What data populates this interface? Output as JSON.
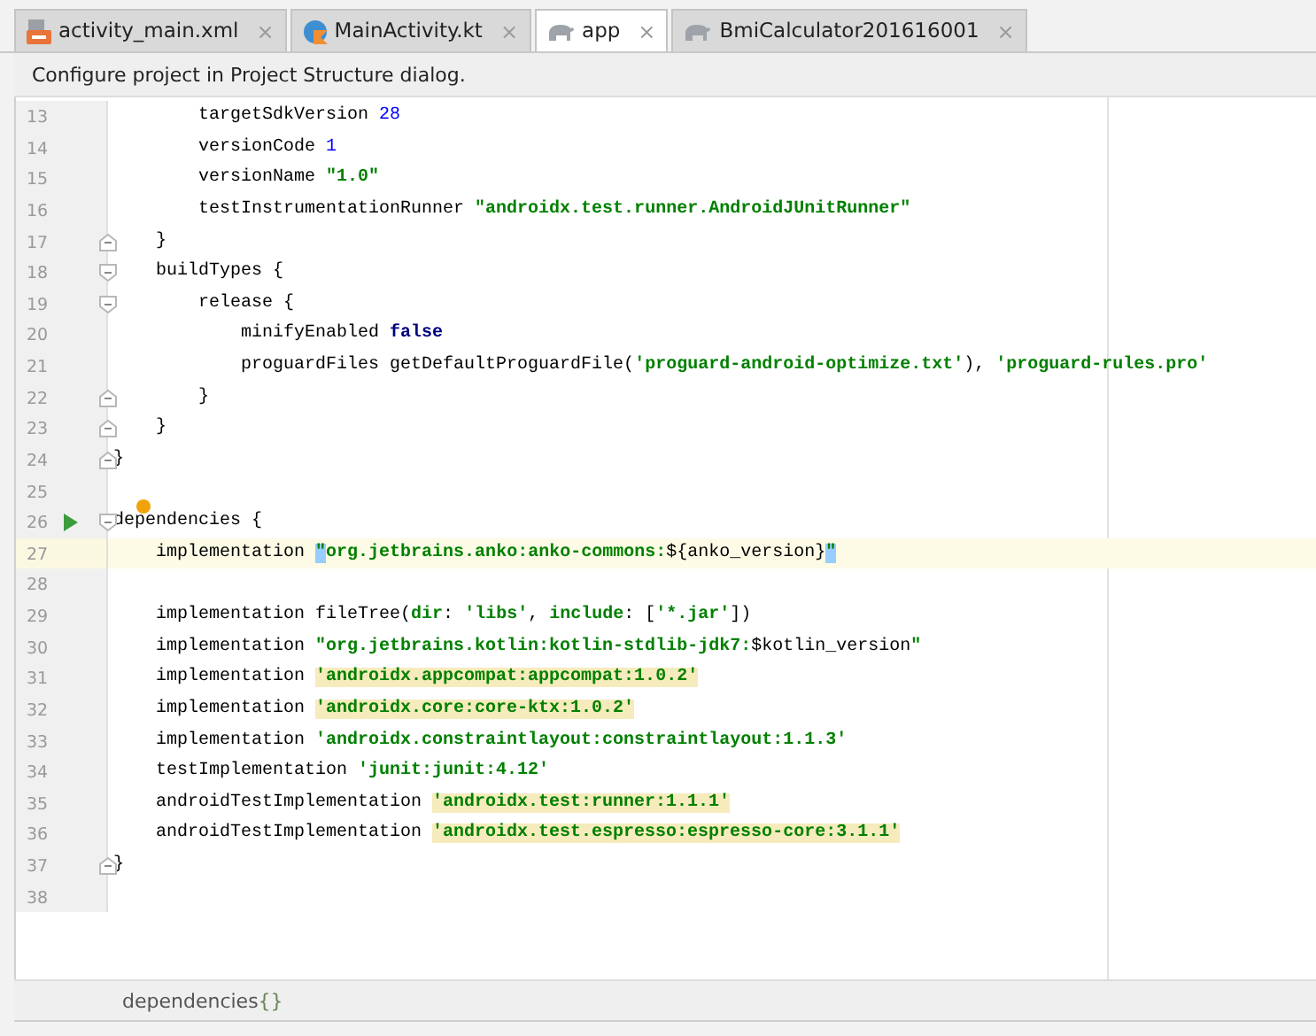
{
  "tabs": [
    {
      "label": "activity_main.xml",
      "selected": false,
      "close": "×"
    },
    {
      "label": "MainActivity.kt",
      "selected": false,
      "close": "×"
    },
    {
      "label": "app",
      "selected": true,
      "close": "×"
    },
    {
      "label": "BmiCalculator201616001",
      "selected": false,
      "close": "×"
    }
  ],
  "banner": "Configure project in Project Structure dialog.",
  "lines": [
    {
      "number": "13",
      "current": false,
      "fold_start": false,
      "fold_end": false,
      "runnable": false,
      "bulb": false,
      "tokens": [
        {
          "kind": "plain",
          "text": "        targetSdkVersion "
        },
        {
          "kind": "number",
          "text": "28"
        }
      ]
    },
    {
      "number": "14",
      "current": false,
      "fold_start": false,
      "fold_end": false,
      "runnable": false,
      "bulb": false,
      "tokens": [
        {
          "kind": "plain",
          "text": "        versionCode "
        },
        {
          "kind": "number",
          "text": "1"
        }
      ]
    },
    {
      "number": "15",
      "current": false,
      "fold_start": false,
      "fold_end": false,
      "runnable": false,
      "bulb": false,
      "tokens": [
        {
          "kind": "plain",
          "text": "        versionName "
        },
        {
          "kind": "string",
          "text": "\"1.0\""
        }
      ]
    },
    {
      "number": "16",
      "current": false,
      "fold_start": false,
      "fold_end": false,
      "runnable": false,
      "bulb": false,
      "tokens": [
        {
          "kind": "plain",
          "text": "        testInstrumentationRunner "
        },
        {
          "kind": "string",
          "text": "\"androidx.test.runner.AndroidJUnitRunner\""
        }
      ]
    },
    {
      "number": "17",
      "current": false,
      "fold_start": false,
      "fold_end": true,
      "runnable": false,
      "bulb": false,
      "tokens": [
        {
          "kind": "plain",
          "text": "    }"
        }
      ]
    },
    {
      "number": "18",
      "current": false,
      "fold_start": true,
      "fold_end": false,
      "runnable": false,
      "bulb": false,
      "tokens": [
        {
          "kind": "plain",
          "text": "    buildTypes {"
        }
      ]
    },
    {
      "number": "19",
      "current": false,
      "fold_start": true,
      "fold_end": false,
      "runnable": false,
      "bulb": false,
      "tokens": [
        {
          "kind": "plain",
          "text": "        release {"
        }
      ]
    },
    {
      "number": "20",
      "current": false,
      "fold_start": false,
      "fold_end": false,
      "runnable": false,
      "bulb": false,
      "tokens": [
        {
          "kind": "plain",
          "text": "            minifyEnabled "
        },
        {
          "kind": "keyword",
          "text": "false"
        }
      ]
    },
    {
      "number": "21",
      "current": false,
      "fold_start": false,
      "fold_end": false,
      "runnable": false,
      "bulb": false,
      "tokens": [
        {
          "kind": "plain",
          "text": "            proguardFiles getDefaultProguardFile("
        },
        {
          "kind": "string",
          "text": "'proguard-android-optimize.txt'"
        },
        {
          "kind": "plain",
          "text": "), "
        },
        {
          "kind": "string",
          "text": "'proguard-rules.pro'"
        }
      ]
    },
    {
      "number": "22",
      "current": false,
      "fold_start": false,
      "fold_end": true,
      "runnable": false,
      "bulb": false,
      "tokens": [
        {
          "kind": "plain",
          "text": "        }"
        }
      ]
    },
    {
      "number": "23",
      "current": false,
      "fold_start": false,
      "fold_end": true,
      "runnable": false,
      "bulb": false,
      "tokens": [
        {
          "kind": "plain",
          "text": "    }"
        }
      ]
    },
    {
      "number": "24",
      "current": false,
      "fold_start": false,
      "fold_end": true,
      "runnable": false,
      "bulb": false,
      "tokens": [
        {
          "kind": "plain",
          "text": "}"
        }
      ]
    },
    {
      "number": "25",
      "current": false,
      "fold_start": false,
      "fold_end": false,
      "runnable": false,
      "bulb": false
    },
    {
      "number": "26",
      "current": false,
      "fold_start": true,
      "fold_end": false,
      "runnable": true,
      "bulb": true,
      "tokens": [
        {
          "kind": "plain",
          "text": "dependencies {"
        }
      ]
    },
    {
      "number": "27",
      "current": true,
      "fold_start": false,
      "fold_end": false,
      "runnable": false,
      "bulb": false,
      "tokens": [
        {
          "kind": "plain",
          "text": "    implementation "
        },
        {
          "kind": "match",
          "text": "\""
        },
        {
          "kind": "string",
          "text": "org.jetbrains.anko:anko-commons:"
        },
        {
          "kind": "plain",
          "text": "${anko_version}"
        },
        {
          "kind": "match",
          "text": "\""
        }
      ]
    },
    {
      "number": "28",
      "current": false,
      "fold_start": false,
      "fold_end": false,
      "runnable": false,
      "bulb": false
    },
    {
      "number": "29",
      "current": false,
      "fold_start": false,
      "fold_end": false,
      "runnable": false,
      "bulb": false,
      "tokens": [
        {
          "kind": "plain",
          "text": "    implementation fileTree("
        },
        {
          "kind": "string",
          "text": "dir"
        },
        {
          "kind": "plain",
          "text": ": "
        },
        {
          "kind": "string",
          "text": "'libs'"
        },
        {
          "kind": "plain",
          "text": ", "
        },
        {
          "kind": "string",
          "text": "include"
        },
        {
          "kind": "plain",
          "text": ": ["
        },
        {
          "kind": "string",
          "text": "'*.jar'"
        },
        {
          "kind": "plain",
          "text": "])"
        }
      ]
    },
    {
      "number": "30",
      "current": false,
      "fold_start": false,
      "fold_end": false,
      "runnable": false,
      "bulb": false,
      "tokens": [
        {
          "kind": "plain",
          "text": "    implementation "
        },
        {
          "kind": "string",
          "text": "\"org.jetbrains.kotlin:kotlin-stdlib-jdk7:"
        },
        {
          "kind": "plain",
          "text": "$kotlin_version"
        },
        {
          "kind": "string",
          "text": "\""
        }
      ]
    },
    {
      "number": "31",
      "current": false,
      "fold_start": false,
      "fold_end": false,
      "runnable": false,
      "bulb": false,
      "tokens": [
        {
          "kind": "plain",
          "text": "    implementation "
        },
        {
          "kind": "warn",
          "text": "'androidx.appcompat:appcompat:1.0.2'"
        }
      ]
    },
    {
      "number": "32",
      "current": false,
      "fold_start": false,
      "fold_end": false,
      "runnable": false,
      "bulb": false,
      "tokens": [
        {
          "kind": "plain",
          "text": "    implementation "
        },
        {
          "kind": "warn",
          "text": "'androidx.core:core-ktx:1.0.2'"
        }
      ]
    },
    {
      "number": "33",
      "current": false,
      "fold_start": false,
      "fold_end": false,
      "runnable": false,
      "bulb": false,
      "tokens": [
        {
          "kind": "plain",
          "text": "    implementation "
        },
        {
          "kind": "string",
          "text": "'androidx.constraintlayout:constraintlayout:1.1.3'"
        }
      ]
    },
    {
      "number": "34",
      "current": false,
      "fold_start": false,
      "fold_end": false,
      "runnable": false,
      "bulb": false,
      "tokens": [
        {
          "kind": "plain",
          "text": "    testImplementation "
        },
        {
          "kind": "string",
          "text": "'junit:junit:4.12'"
        }
      ]
    },
    {
      "number": "35",
      "current": false,
      "fold_start": false,
      "fold_end": false,
      "runnable": false,
      "bulb": false,
      "tokens": [
        {
          "kind": "plain",
          "text": "    androidTestImplementation "
        },
        {
          "kind": "warn",
          "text": "'androidx.test:runner:1.1.1'"
        }
      ]
    },
    {
      "number": "36",
      "current": false,
      "fold_start": false,
      "fold_end": false,
      "runnable": false,
      "bulb": false,
      "tokens": [
        {
          "kind": "plain",
          "text": "    androidTestImplementation "
        },
        {
          "kind": "warn",
          "text": "'androidx.test.espresso:espresso-core:3.1.1'"
        }
      ]
    },
    {
      "number": "37",
      "current": false,
      "fold_start": false,
      "fold_end": true,
      "runnable": false,
      "bulb": false,
      "tokens": [
        {
          "kind": "plain",
          "text": "}"
        }
      ]
    },
    {
      "number": "38",
      "current": false,
      "fold_start": false,
      "fold_end": false,
      "runnable": false,
      "bulb": false
    }
  ],
  "breadcrumb": {
    "name": "dependencies",
    "braces": "{}"
  }
}
